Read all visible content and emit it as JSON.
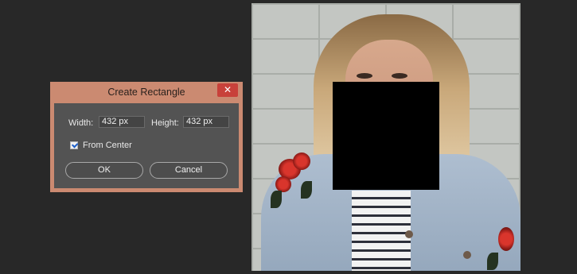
{
  "dialog": {
    "title": "Create Rectangle",
    "close_glyph": "✕",
    "width_label": "Width:",
    "width_value": "432 px",
    "height_label": "Height:",
    "height_value": "432 px",
    "from_center_label": "From Center",
    "from_center_checked": true,
    "ok_label": "OK",
    "cancel_label": "Cancel"
  },
  "canvas": {
    "shape_color": "#000000",
    "dialog_frame_color": "#cb8a71",
    "close_button_color": "#c8413a"
  }
}
